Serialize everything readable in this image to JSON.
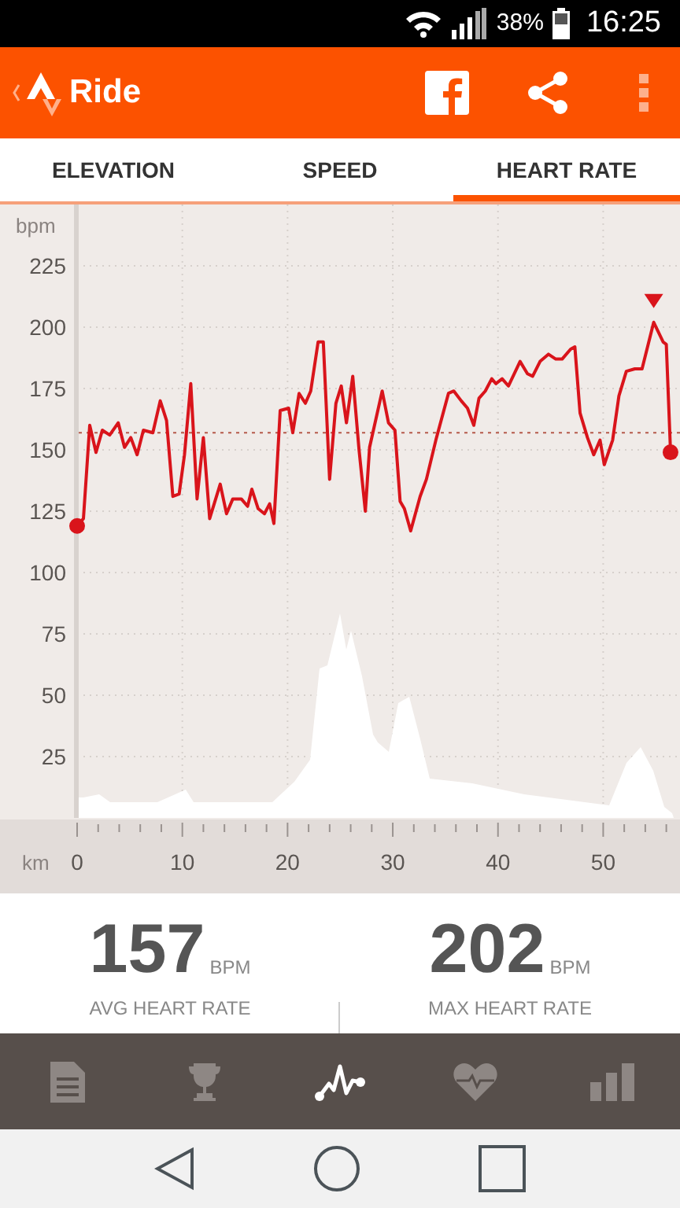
{
  "status_bar": {
    "battery": "38%",
    "time": "16:25"
  },
  "app_bar": {
    "title": "Ride"
  },
  "tabs": [
    {
      "label": "ELEVATION",
      "selected": false
    },
    {
      "label": "SPEED",
      "selected": false
    },
    {
      "label": "HEART RATE",
      "selected": true
    }
  ],
  "chart": {
    "chart_data": {
      "type": "line",
      "ylabel": "bpm",
      "xlabel": "km",
      "xlim": [
        0,
        57.3
      ],
      "ylim": [
        0,
        250
      ],
      "xticks": [
        0,
        10,
        20,
        30,
        40,
        50
      ],
      "yticks": [
        25,
        50,
        75,
        100,
        125,
        150,
        175,
        200,
        225
      ],
      "x": [
        0,
        0.6,
        1.2,
        1.8,
        2.4,
        3.1,
        3.9,
        4.5,
        5.1,
        5.7,
        6.3,
        7.2,
        7.9,
        8.5,
        9.1,
        9.7,
        10.2,
        10.8,
        11.4,
        12.0,
        12.6,
        13.6,
        14.2,
        14.8,
        15.6,
        16.2,
        16.6,
        17.2,
        17.8,
        18.3,
        18.7,
        19.3,
        20.1,
        20.5,
        21.1,
        21.7,
        22.2,
        22.9,
        23.4,
        24.0,
        24.6,
        25.1,
        25.6,
        26.2,
        26.8,
        27.4,
        27.8,
        29.0,
        29.6,
        30.2,
        30.7,
        31.1,
        31.7,
        32.6,
        33.2,
        34.1,
        35.3,
        35.8,
        36.5,
        37.1,
        37.7,
        38.2,
        38.8,
        39.4,
        39.8,
        40.4,
        41.0,
        42.1,
        42.8,
        43.3,
        44.0,
        44.8,
        45.5,
        46.1,
        46.9,
        47.3,
        47.8,
        48.5,
        49.1,
        49.7,
        50.1,
        50.9,
        51.5,
        52.2,
        53.0,
        53.7,
        54.8,
        55.7,
        56.0,
        56.4
      ],
      "series": [
        {
          "color": "#d9141b",
          "values": [
            119,
            122,
            160,
            149,
            158,
            156,
            161,
            151,
            155,
            148,
            158,
            157,
            170,
            162,
            131,
            132,
            148,
            177,
            130,
            155,
            122,
            136,
            124,
            130,
            130,
            127,
            134,
            126,
            124,
            128,
            120,
            166,
            167,
            157,
            173,
            169,
            174,
            194,
            194,
            138,
            169,
            176,
            161,
            180,
            150,
            125,
            151,
            174,
            161,
            158,
            129,
            126,
            117,
            131,
            138,
            154,
            173,
            174,
            170,
            167,
            160,
            171,
            174,
            179,
            177,
            179,
            176,
            186,
            181,
            180,
            186,
            189,
            187,
            187,
            191,
            192,
            165,
            155,
            148,
            154,
            144,
            154,
            172,
            182,
            183,
            183,
            202,
            194,
            193,
            149
          ]
        }
      ],
      "grid": true,
      "ref_lines": [
        {
          "axis": "y",
          "value": 157
        }
      ]
    }
  },
  "stats": [
    {
      "value": "157",
      "unit": "BPM",
      "label": "AVG HEART RATE"
    },
    {
      "value": "202",
      "unit": "BPM",
      "label": "MAX HEART RATE"
    }
  ],
  "bottom_nav": [
    {
      "selected": false
    },
    {
      "selected": false
    },
    {
      "selected": true
    },
    {
      "selected": false
    },
    {
      "selected": false
    }
  ]
}
